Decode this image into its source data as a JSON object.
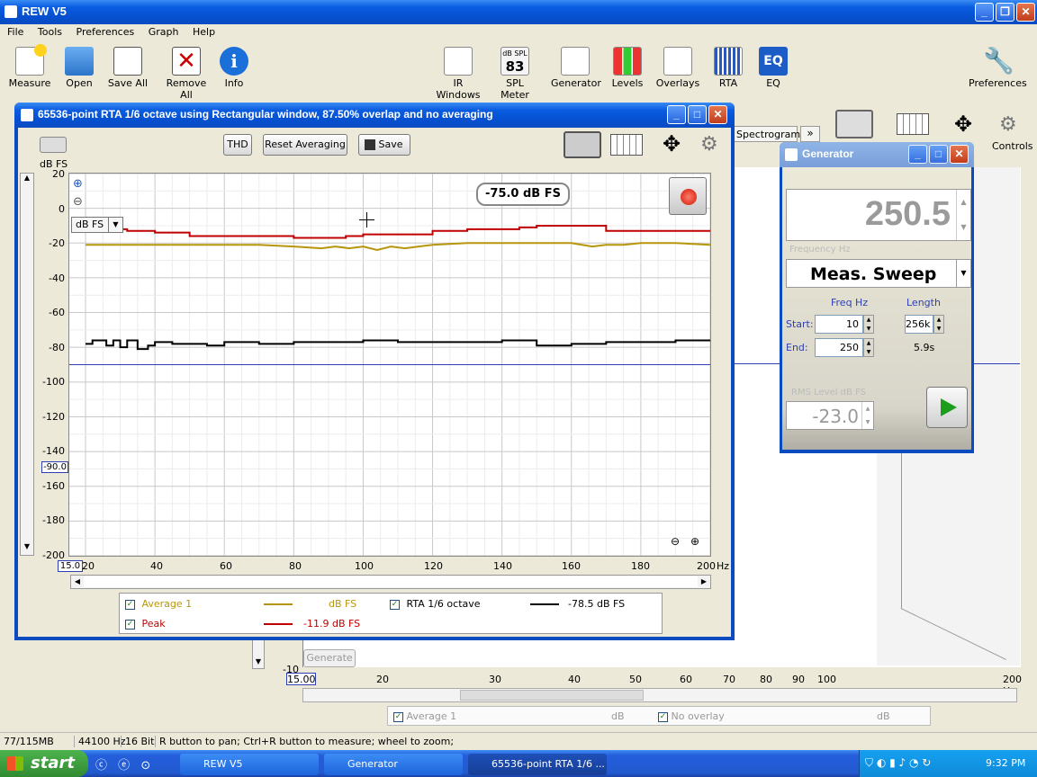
{
  "app": {
    "title": "REW V5"
  },
  "menu": [
    "File",
    "Tools",
    "Preferences",
    "Graph",
    "Help"
  ],
  "toolbar_left": [
    "Measure",
    "Open",
    "Save All",
    "Remove All",
    "Info"
  ],
  "toolbar_right": [
    "IR Windows",
    "SPL Meter",
    "Generator",
    "Levels",
    "Overlays",
    "RTA",
    "EQ"
  ],
  "spl_badge": {
    "unit": "dB SPL",
    "value": "83"
  },
  "preferences_label": "Preferences",
  "controls_label": "Controls",
  "spectrogram_tab": "Spectrogram",
  "more_tabs": "»",
  "rta_window": {
    "title": "65536-point RTA 1/6 octave using Rectangular window, 87.50% overlap and no averaging",
    "thd_button": "THD",
    "reset_button": "Reset Averaging",
    "save_button": "Save",
    "y_unit_label": "dB FS",
    "unit_select": "dB FS",
    "cursor_readout": "-75.0 dB FS",
    "level_marker": "-90.0",
    "x_start_readout": "15.0",
    "x_unit": "Hz"
  },
  "legend": {
    "average_label": "Average 1",
    "average_value": "dB FS",
    "peak_label": "Peak",
    "peak_value": "-11.9 dB FS",
    "rta_label": "RTA 1/6 octave",
    "rta_value": "-78.5 dB FS"
  },
  "chart_data": {
    "type": "line",
    "xlim": [
      15,
      200
    ],
    "ylim": [
      -200,
      20
    ],
    "xticks": [
      "20",
      "40",
      "60",
      "80",
      "100",
      "120",
      "140",
      "160",
      "180",
      "200"
    ],
    "yticks": [
      "20",
      "0",
      "-20",
      "-40",
      "-60",
      "-80",
      "-100",
      "-120",
      "-140",
      "-160",
      "-180",
      "-200"
    ],
    "series": [
      {
        "name": "Peak",
        "color": "#c00000",
        "x": [
          20,
          28,
          32,
          40,
          50,
          65,
          80,
          90,
          95,
          100,
          110,
          120,
          130,
          140,
          145,
          150,
          160,
          170,
          175,
          180,
          190,
          200
        ],
        "y": [
          -12,
          -12,
          -13,
          -14,
          -16,
          -16,
          -17,
          -17,
          -16,
          -15,
          -15,
          -13,
          -12,
          -12,
          -11,
          -10,
          -10,
          -13,
          -13,
          -13,
          -13,
          -13
        ]
      },
      {
        "name": "Average 1",
        "color": "#b8960b",
        "x": [
          20,
          30,
          40,
          50,
          60,
          70,
          80,
          88,
          92,
          96,
          100,
          104,
          108,
          112,
          116,
          120,
          130,
          140,
          150,
          160,
          166,
          170,
          175,
          180,
          190,
          200
        ],
        "y": [
          -21,
          -21,
          -21,
          -21,
          -21,
          -21,
          -22,
          -23,
          -22,
          -23,
          -22,
          -24,
          -22,
          -23,
          -22,
          -21,
          -20,
          -20,
          -20,
          -20,
          -22,
          -21,
          -21,
          -20,
          -20,
          -21
        ]
      },
      {
        "name": "RTA 1/6 octave",
        "color": "#000000",
        "x": [
          20,
          22,
          24,
          26,
          28,
          30,
          32,
          35,
          38,
          40,
          45,
          50,
          55,
          60,
          70,
          80,
          90,
          100,
          110,
          120,
          130,
          140,
          150,
          160,
          170,
          180,
          190,
          200
        ],
        "y": [
          -78,
          -76,
          -76,
          -79,
          -76,
          -80,
          -76,
          -81,
          -79,
          -77,
          -78,
          -78,
          -79,
          -77,
          -78,
          -77,
          -77,
          -76,
          -77,
          -77,
          -77,
          -76,
          -79,
          -78,
          -77,
          -77,
          -76,
          -76
        ]
      }
    ],
    "reference_line": -90
  },
  "background_graph": {
    "x_start_readout": "15.00",
    "x_ticks": [
      "20",
      "30",
      "40",
      "50",
      "60",
      "70",
      "80",
      "90",
      "100",
      "200 Hz"
    ],
    "y_label": "-10",
    "generate_button": "Generate",
    "legend_average": "Average 1",
    "legend_average_unit": "dB",
    "legend_overlay": "No overlay",
    "legend_overlay_unit": "dB"
  },
  "generator": {
    "title": "Generator",
    "frequency": "250.5",
    "frequency_label": "Frequency Hz",
    "mode": "Meas. Sweep",
    "freq_col": "Freq Hz",
    "length_col": "Length",
    "start_label": "Start:",
    "start_value": "10",
    "end_label": "End:",
    "end_value": "250",
    "length_value": "256k",
    "duration": "5.9s",
    "rms_label": "RMS Level dB FS",
    "rms_value": "-23.0"
  },
  "status": {
    "memory": "77/115MB",
    "rate": "44100 Hz",
    "bits": "16 Bit",
    "hint": "R button to pan; Ctrl+R button to measure; wheel to zoom;"
  },
  "taskbar": {
    "start": "start",
    "items": [
      "REW V5",
      "Generator",
      "65536-point RTA 1/6 ..."
    ],
    "clock": "9:32 PM"
  },
  "colors": {
    "xp_blue": "#0a5ce0",
    "peak": "#c00000",
    "average": "#b8960b",
    "rta": "#000000",
    "play": "#1c9e1c"
  }
}
